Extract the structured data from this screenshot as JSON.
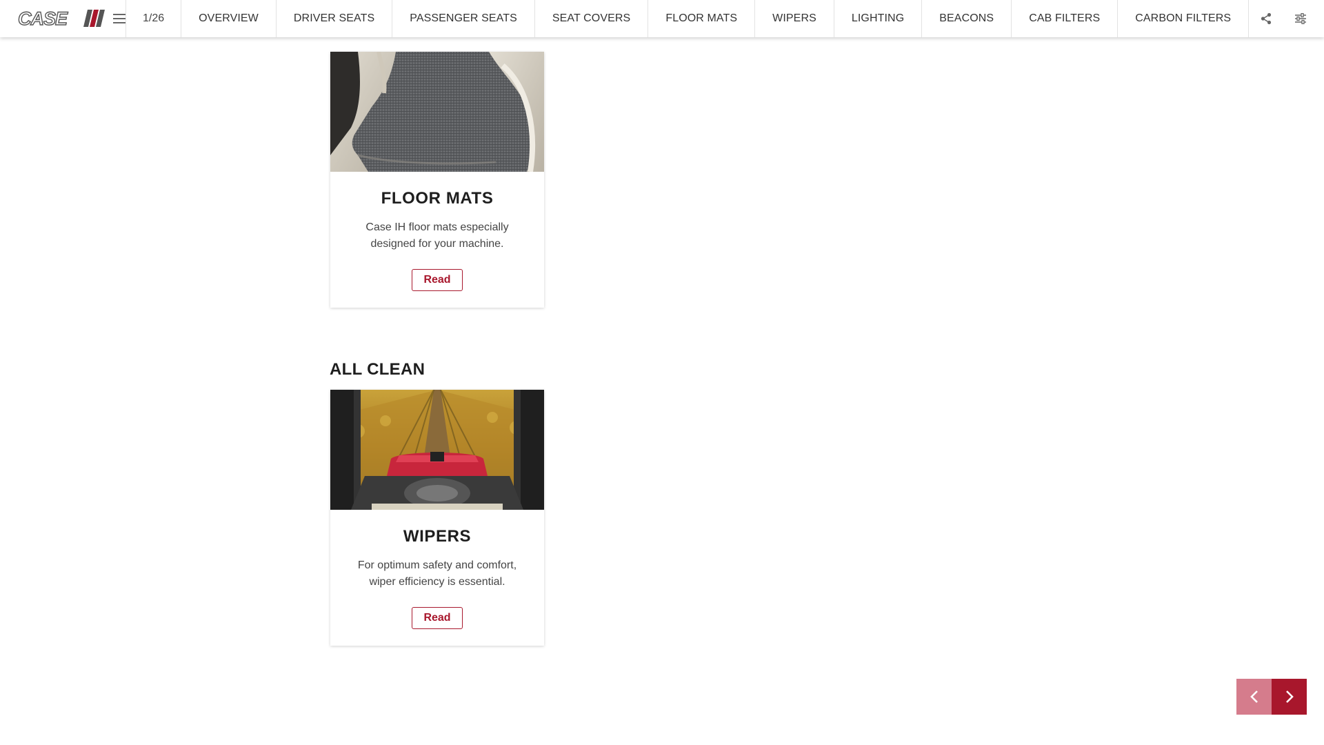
{
  "brand": {
    "logo_text": "CASE IH",
    "accent_color": "#a8172c"
  },
  "header": {
    "page_counter": "1/26",
    "nav": [
      "OVERVIEW",
      "DRIVER SEATS",
      "PASSENGER SEATS",
      "SEAT COVERS",
      "FLOOR MATS",
      "WIPERS",
      "LIGHTING",
      "BEACONS",
      "CAB FILTERS",
      "CARBON FILTERS"
    ],
    "tools": [
      "share-icon",
      "sliders-icon",
      "info-icon"
    ]
  },
  "cards": [
    {
      "title": "FLOOR MATS",
      "description": "Case IH floor mats especially designed for your machine.",
      "button": "Read",
      "image": "floor-mat-photo"
    },
    {
      "section": "ALL CLEAN",
      "title": "WIPERS",
      "description": "For optimum safety and comfort, wiper efficiency is essential.",
      "button": "Read",
      "image": "vineyard-cab-view-photo"
    }
  ],
  "pager": {
    "prev_icon": "chevron-left-icon",
    "next_icon": "chevron-right-icon"
  }
}
